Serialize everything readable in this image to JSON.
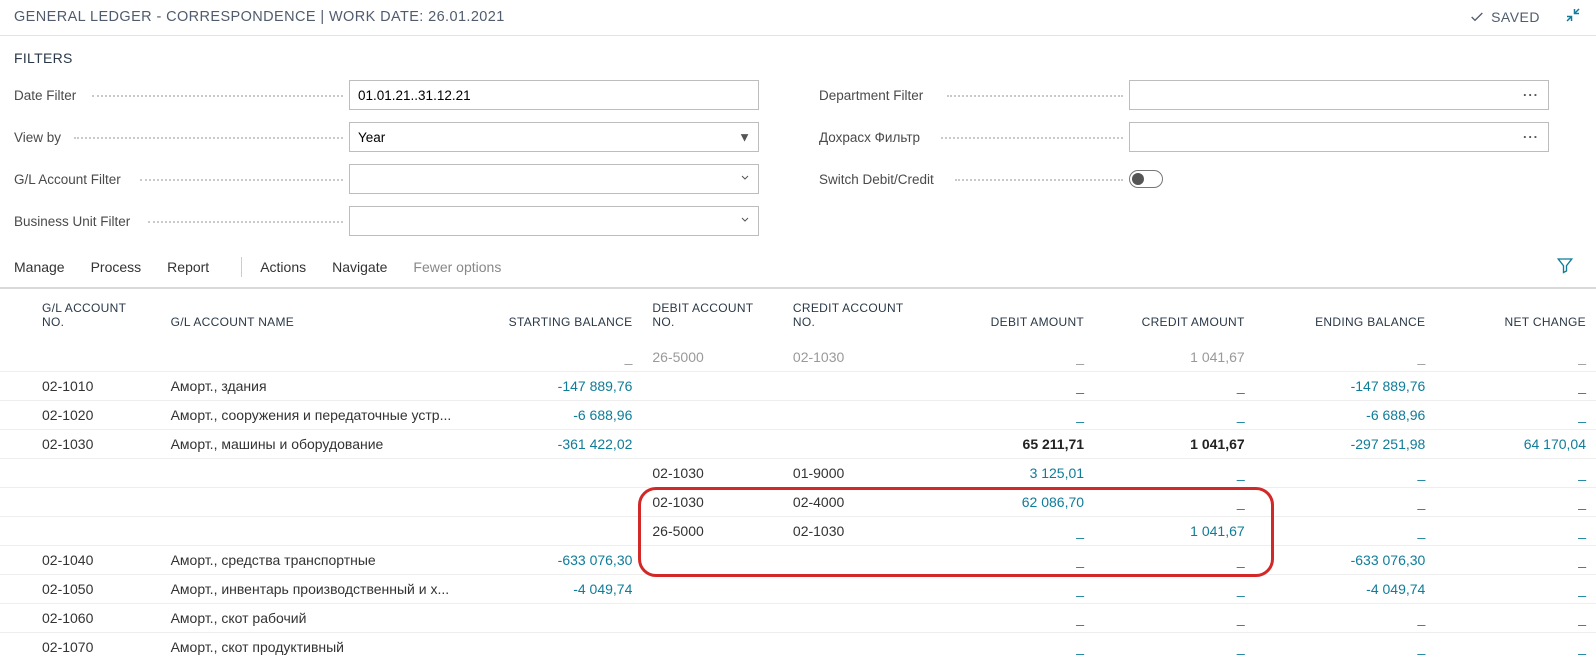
{
  "header": {
    "title": "GENERAL LEDGER - CORRESPONDENCE | WORK DATE: 26.01.2021",
    "saved": "SAVED"
  },
  "filters": {
    "section_title": "FILTERS",
    "date_filter_label": "Date Filter",
    "date_filter_value": "01.01.21..31.12.21",
    "view_by_label": "View by",
    "view_by_value": "Year",
    "gl_account_filter_label": "G/L Account Filter",
    "gl_account_filter_value": "",
    "business_unit_filter_label": "Business Unit Filter",
    "business_unit_filter_value": "",
    "department_filter_label": "Department Filter",
    "department_filter_value": "",
    "dokhrash_filter_label": "Дохрасх Фильтр",
    "dokhrash_filter_value": "",
    "switch_label": "Switch Debit/Credit"
  },
  "toolbar": {
    "manage": "Manage",
    "process": "Process",
    "report": "Report",
    "actions": "Actions",
    "navigate": "Navigate",
    "fewer": "Fewer options"
  },
  "columns": {
    "gl_no": "G/L ACCOUNT NO.",
    "gl_name": "G/L ACCOUNT NAME",
    "start_bal": "STARTING BALANCE",
    "debit_acc": "DEBIT ACCOUNT NO.",
    "credit_acc": "CREDIT ACCOUNT NO.",
    "debit_amt": "DEBIT AMOUNT",
    "credit_amt": "CREDIT AMOUNT",
    "end_bal": "ENDING BALANCE",
    "net": "NET CHANGE"
  },
  "rows": [
    {
      "partial": true,
      "gl_no": "",
      "gl_name": "",
      "start": "_",
      "dacc": "26-5000",
      "cacc": "02-1030",
      "damt": "_",
      "camt": "1 041,67",
      "end": "_",
      "net": "_"
    },
    {
      "gl_no": "02-1010",
      "gl_name": "Аморт., здания",
      "start": "-147 889,76",
      "dacc": "",
      "cacc": "",
      "damt": "_",
      "camt": "_",
      "end": "-147 889,76",
      "net": "_"
    },
    {
      "gl_no": "02-1020",
      "gl_name": "Аморт., сооружения и передаточные устр...",
      "start": "-6 688,96",
      "dacc": "",
      "cacc": "",
      "damt": "_",
      "camt": "_",
      "end": "-6 688,96",
      "net": "_"
    },
    {
      "gl_no": "02-1030",
      "gl_name": "Аморт., машины и оборудование",
      "start": "-361 422,02",
      "dacc": "",
      "cacc": "",
      "damt": "65 211,71",
      "damt_bold": true,
      "camt": "1 041,67",
      "camt_bold": true,
      "end": "-297 251,98",
      "net": "64 170,04"
    },
    {
      "gl_no": "",
      "gl_name": "",
      "start": "",
      "dacc": "02-1030",
      "cacc": "01-9000",
      "damt": "3 125,01",
      "damt_teal": true,
      "camt": "_",
      "end": "_",
      "net": "_"
    },
    {
      "gl_no": "",
      "gl_name": "",
      "start": "",
      "dacc": "02-1030",
      "cacc": "02-4000",
      "damt": "62 086,70",
      "damt_teal": true,
      "camt": "_",
      "end": "_",
      "net": "_"
    },
    {
      "gl_no": "",
      "gl_name": "",
      "start": "",
      "dacc": "26-5000",
      "cacc": "02-1030",
      "damt": "_",
      "camt": "1 041,67",
      "camt_teal": true,
      "end": "_",
      "net": "_"
    },
    {
      "gl_no": "02-1040",
      "gl_name": "Аморт., средства транспортные",
      "start": "-633 076,30",
      "dacc": "",
      "cacc": "",
      "damt": "_",
      "camt": "_",
      "end": "-633 076,30",
      "net": "_"
    },
    {
      "gl_no": "02-1050",
      "gl_name": "Аморт., инвентарь производственный и х...",
      "start": "-4 049,74",
      "dacc": "",
      "cacc": "",
      "damt": "_",
      "camt": "_",
      "end": "-4 049,74",
      "net": "_"
    },
    {
      "gl_no": "02-1060",
      "gl_name": "Аморт., скот рабочий",
      "start": "",
      "dacc": "",
      "cacc": "",
      "damt": "_",
      "camt": "_",
      "end": "_",
      "net": "_"
    },
    {
      "gl_no": "02-1070",
      "gl_name": "Аморт., скот продуктивный",
      "start": "",
      "dacc": "",
      "cacc": "",
      "damt": "_",
      "camt": "_",
      "end": "_",
      "net": "_"
    }
  ]
}
